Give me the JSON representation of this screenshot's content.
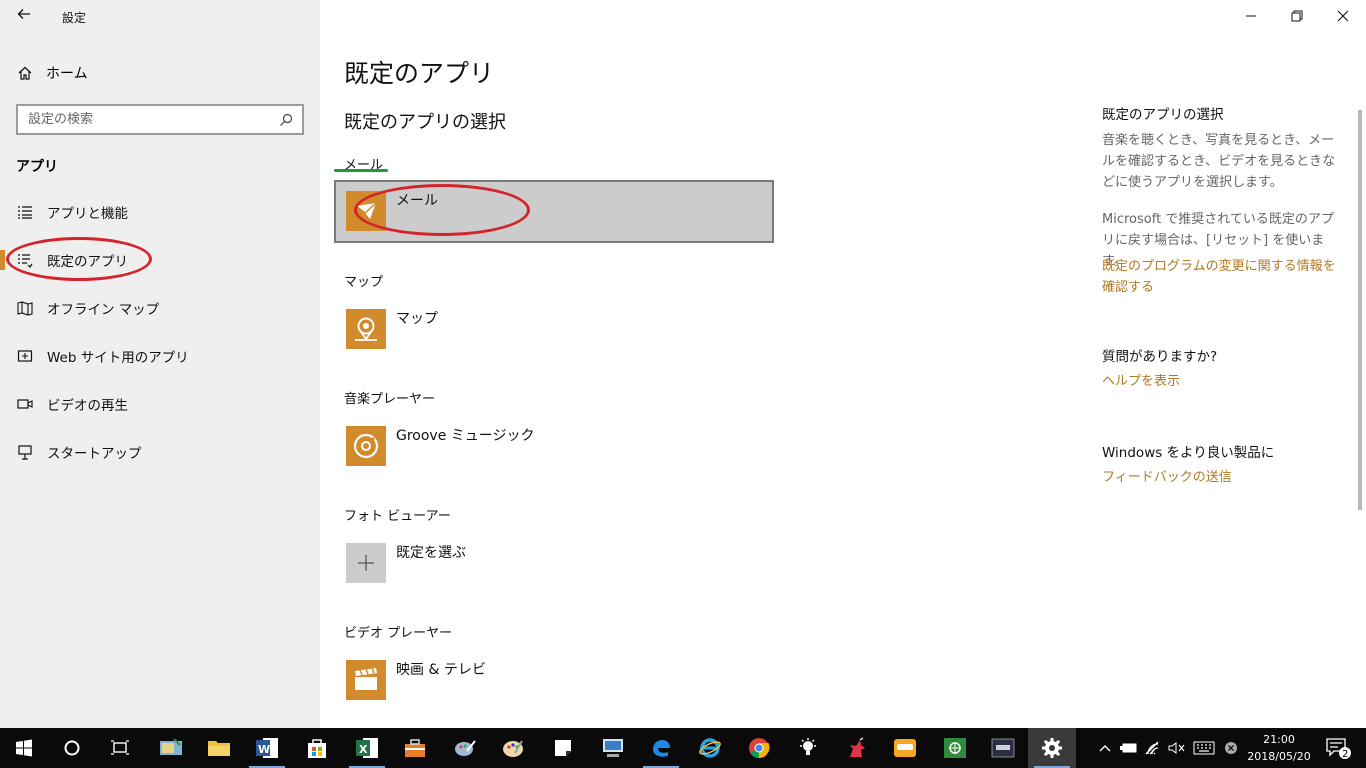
{
  "window": {
    "title": "設定",
    "controls": {
      "minimize": "—",
      "maximize": "❐",
      "close": "✕"
    }
  },
  "sidebar": {
    "home_label": "ホーム",
    "search_placeholder": "設定の検索",
    "section_title": "アプリ",
    "items": [
      {
        "label": "アプリと機能",
        "icon": "list-icon"
      },
      {
        "label": "既定のアプリ",
        "icon": "default-apps-icon",
        "active": true
      },
      {
        "label": "オフライン マップ",
        "icon": "map-icon"
      },
      {
        "label": "Web サイト用のアプリ",
        "icon": "website-apps-icon"
      },
      {
        "label": "ビデオの再生",
        "icon": "video-icon"
      },
      {
        "label": "スタートアップ",
        "icon": "startup-icon"
      }
    ]
  },
  "main": {
    "title": "既定のアプリ",
    "subtitle": "既定のアプリの選択",
    "categories": [
      {
        "label": "メール",
        "app": "メール",
        "icon": "mail-icon"
      },
      {
        "label": "マップ",
        "app": "マップ",
        "icon": "maps-icon"
      },
      {
        "label": "音楽プレーヤー",
        "app": "Groove ミュージック",
        "icon": "groove-music-icon"
      },
      {
        "label": "フォト ビューアー",
        "app": "既定を選ぶ",
        "icon": "plus-icon"
      },
      {
        "label": "ビデオ プレーヤー",
        "app": "映画 & テレビ",
        "icon": "movies-tv-icon"
      }
    ]
  },
  "right": {
    "heading1": "既定のアプリの選択",
    "text1": "音楽を聴くとき、写真を見るとき、メールを確認するとき、ビデオを見るときなどに使うアプリを選択します。",
    "text2": "Microsoft で推奨されている既定のアプリに戻す場合は、[リセット] を使います。",
    "link1": "既定のプログラムの変更に関する情報を確認する",
    "heading2": "質問がありますか?",
    "link2": "ヘルプを表示",
    "heading3": "Windows をより良い製品に",
    "link3": "フィードバックの送信"
  },
  "taskbar": {
    "time": "21:00",
    "date": "2018/05/20",
    "notification_count": "2",
    "accent": "#d18a2c"
  }
}
